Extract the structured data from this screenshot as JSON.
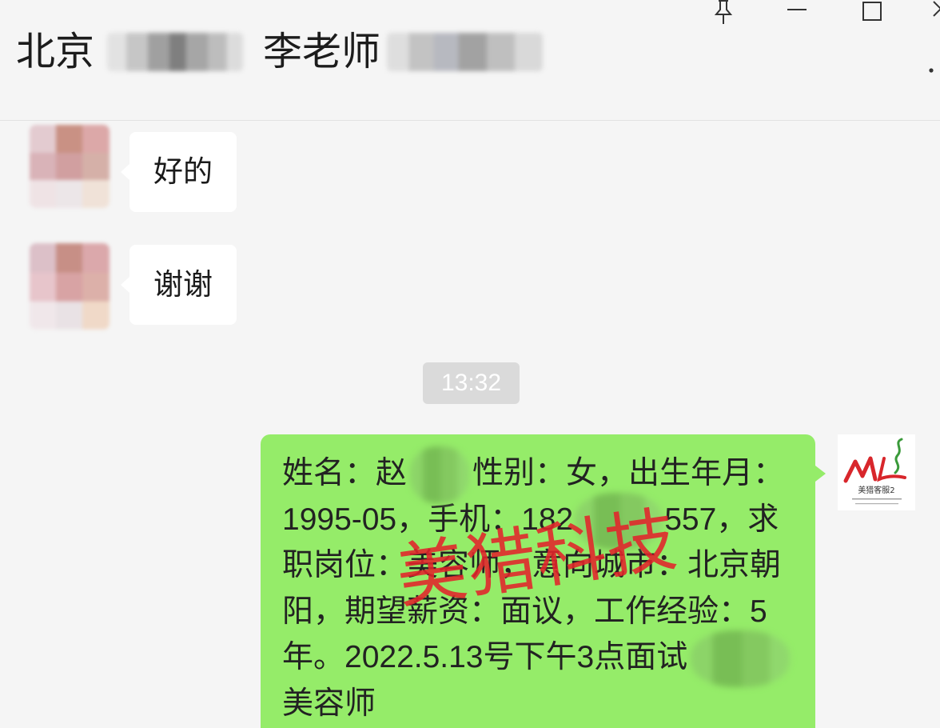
{
  "window_controls": {
    "pin": "pin-icon",
    "minimize": "minimize-icon",
    "maximize": "maximize-icon",
    "close": "close-icon",
    "more": "more-icon"
  },
  "header": {
    "title_location": "北京",
    "title_name": "李老师"
  },
  "chat": {
    "incoming": [
      {
        "text": "好的"
      },
      {
        "text": "谢谢"
      }
    ],
    "timestamp": "13:32",
    "outgoing": {
      "lines": [
        {
          "text": "姓名：赵",
          "text_after": "性别：女，出生年月："
        },
        {
          "text": "1995-05，手机：182",
          "text_after": "557，求"
        },
        {
          "text": "职岗位：美容师，意向城市：北京朝"
        },
        {
          "text": "阳，期望薪资：面议，工作经验：5"
        },
        {
          "text": "年。2022.5.13号下午3点面试"
        },
        {
          "text": "美容师"
        }
      ]
    }
  },
  "watermark": {
    "text": "美猎科技"
  },
  "self_avatar": {
    "logo_text": "美猎客服2"
  },
  "colors": {
    "background": "#f5f5f5",
    "incoming_bubble": "#ffffff",
    "outgoing_bubble": "#95ec69",
    "timestamp_bg": "#dadada",
    "text": "#1a1a1a",
    "watermark": "#e3242b",
    "logo_red": "#d8262b",
    "logo_green": "#3a9a3a"
  }
}
